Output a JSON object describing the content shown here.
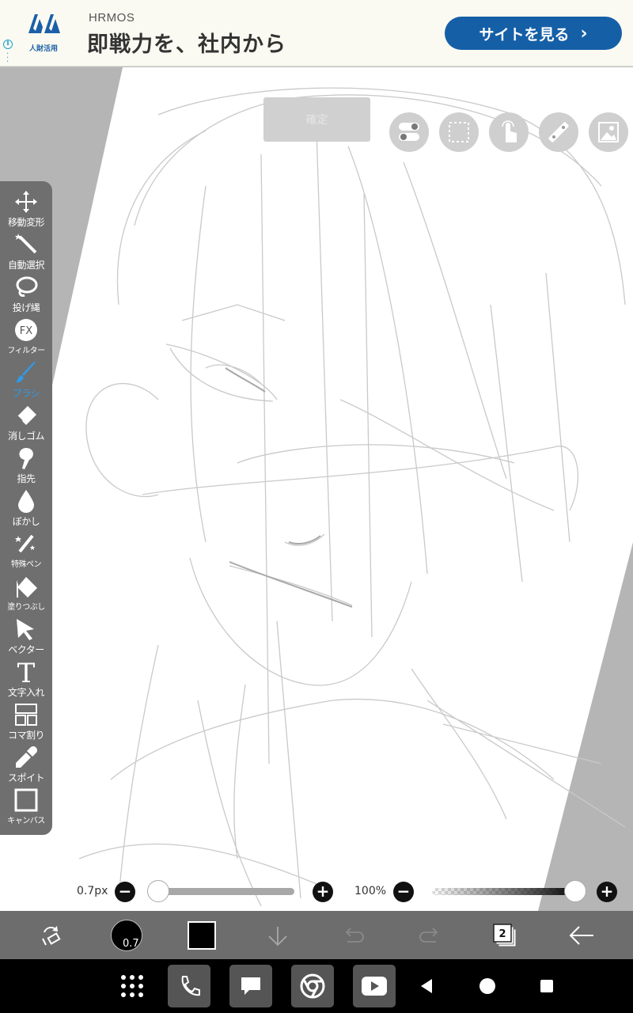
{
  "ad": {
    "brand": "HRMOS",
    "headline": "即戦力を、社内から",
    "logo_sub": "人財活用",
    "cta_label": "サイトを見る",
    "info_icon": "info-icon",
    "accent": "#155fa7"
  },
  "canvas": {
    "confirm_label": "確定",
    "top_tools": [
      "toggle-icon",
      "selection-icon",
      "touch-icon",
      "ruler-icon",
      "image-icon"
    ]
  },
  "toolbar": {
    "items": [
      {
        "label": "移動変形",
        "icon": "move-icon"
      },
      {
        "label": "自動選択",
        "icon": "magic-wand-icon"
      },
      {
        "label": "投げ縄",
        "icon": "lasso-icon"
      },
      {
        "label": "フィルター",
        "icon": "fx-icon"
      },
      {
        "label": "ブラシ",
        "icon": "brush-icon"
      },
      {
        "label": "消しゴム",
        "icon": "eraser-icon"
      },
      {
        "label": "指先",
        "icon": "smudge-icon"
      },
      {
        "label": "ぼかし",
        "icon": "blur-icon"
      },
      {
        "label": "特殊ペン",
        "icon": "special-pen-icon"
      },
      {
        "label": "塗りつぶし",
        "icon": "fill-icon"
      },
      {
        "label": "ベクター",
        "icon": "vector-icon"
      },
      {
        "label": "文字入れ",
        "icon": "text-icon"
      },
      {
        "label": "コマ割り",
        "icon": "frame-divider-icon"
      },
      {
        "label": "スポイト",
        "icon": "eyedropper-icon"
      },
      {
        "label": "キャンバス",
        "icon": "canvas-icon"
      }
    ],
    "active_index": 4,
    "active_color": "#2f9ae6"
  },
  "sliders": {
    "size_label": "0.7px",
    "size_fraction": 0.0,
    "opacity_label": "100%",
    "opacity_fraction": 1.0
  },
  "appbar": {
    "brush_size": "0.7",
    "color": "#000000",
    "layer_count": "2",
    "icons": [
      "swap-icon",
      "brush-preview",
      "color-swatch",
      "download-icon",
      "undo-icon",
      "redo-icon",
      "layers-icon",
      "back-icon"
    ]
  },
  "navbar": {
    "apps": [
      "app-drawer-icon",
      "phone-icon",
      "messages-icon",
      "chrome-icon",
      "youtube-icon"
    ],
    "buttons": [
      "nav-back-icon",
      "nav-home-icon",
      "nav-recents-icon"
    ]
  }
}
